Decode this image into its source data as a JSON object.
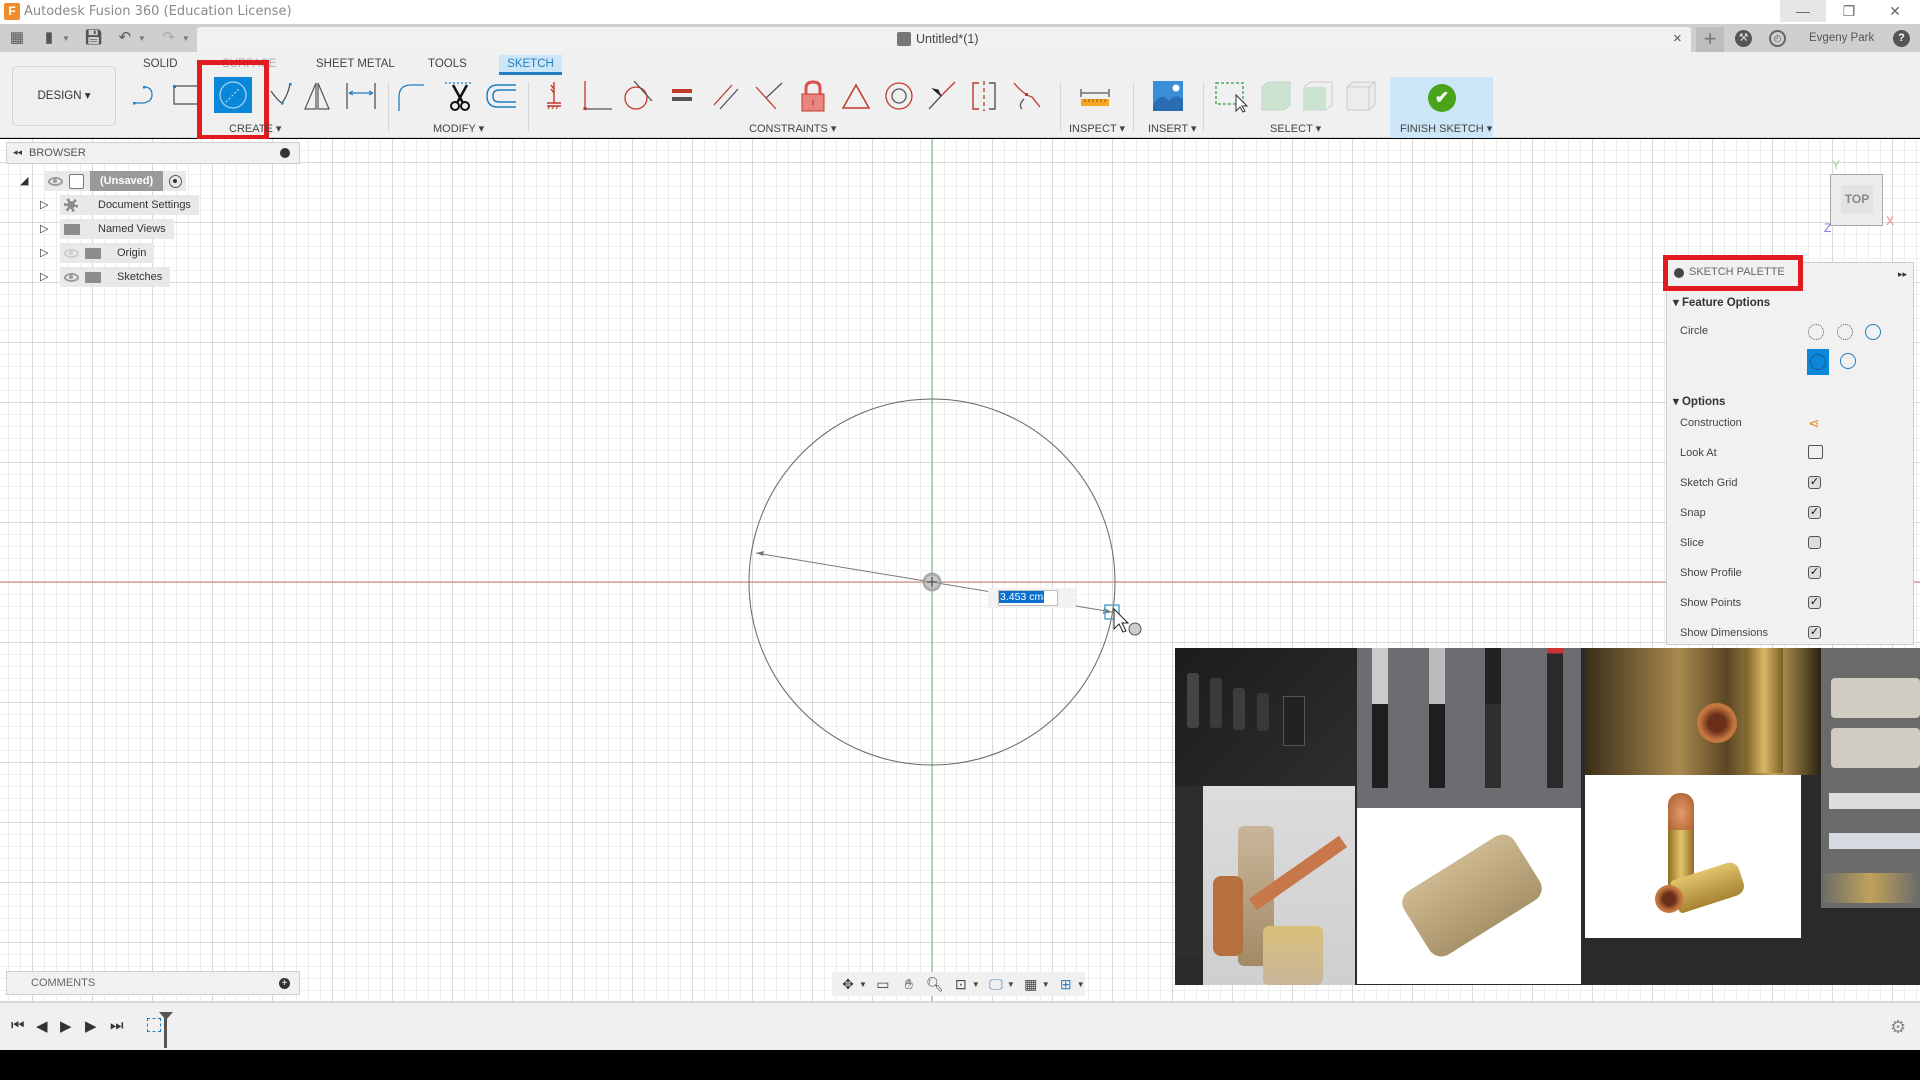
{
  "window": {
    "app_title": "Autodesk Fusion 360 (Education License)",
    "app_logo": "F",
    "controls": {
      "minimize": "—",
      "maximize": "❐",
      "close": "✕"
    }
  },
  "tabstrip": {
    "quick_access": [
      "grid-icon",
      "file-icon",
      "save-icon",
      "undo-icon",
      "redo-icon"
    ],
    "document_title": "Untitled*(1)",
    "close_tab": "×",
    "new_tab": "+",
    "user_name": "Evgeny Park",
    "help": "?"
  },
  "ribbon": {
    "workspace_button": "DESIGN ▾",
    "tabs": [
      "SOLID",
      "SURFACE",
      "SHEET METAL",
      "TOOLS",
      "SKETCH"
    ],
    "active_tab": "SKETCH",
    "groups": {
      "create": "CREATE ▾",
      "modify": "MODIFY ▾",
      "constraints": "CONSTRAINTS ▾",
      "inspect": "INSPECT ▾",
      "insert": "INSERT ▾",
      "select": "SELECT ▾",
      "finish": "FINISH SKETCH ▾"
    },
    "create_tools": [
      "line",
      "rectangle",
      "circle",
      "spline",
      "mirror",
      "sketch-dimension"
    ],
    "active_tool": "circle",
    "modify_tools": [
      "fillet",
      "trim",
      "offset"
    ],
    "constraint_tools": [
      "horizontal-vertical",
      "coincident",
      "tangent",
      "equal",
      "parallel",
      "perpendicular",
      "fix-unfix",
      "midpoint",
      "concentric",
      "collinear",
      "symmetry",
      "curvature"
    ]
  },
  "browser": {
    "title": "BROWSER",
    "root": "(Unsaved)",
    "items": [
      {
        "label": "Document Settings",
        "icon": "gear-icon",
        "eye": false
      },
      {
        "label": "Named Views",
        "icon": "folder-icon",
        "eye": false
      },
      {
        "label": "Origin",
        "icon": "folder-icon",
        "eye": "hidden"
      },
      {
        "label": "Sketches",
        "icon": "folder-icon",
        "eye": "visible"
      }
    ]
  },
  "comments": {
    "title": "COMMENTS"
  },
  "canvas": {
    "dimension_value": "3.453 cm",
    "viewcube": {
      "face": "TOP",
      "axis_y": "Y",
      "axis_x": "X",
      "axis_z": "Z"
    }
  },
  "palette": {
    "title": "SKETCH PALETTE",
    "feature_options_label": "Feature Options",
    "circle_label": "Circle",
    "options_label": "Options",
    "rows": [
      {
        "label": "Construction",
        "control": "construction-icon"
      },
      {
        "label": "Look At",
        "control": "look-at-icon"
      },
      {
        "label": "Sketch Grid",
        "checked": true
      },
      {
        "label": "Snap",
        "checked": true
      },
      {
        "label": "Slice",
        "checked": false
      },
      {
        "label": "Show Profile",
        "checked": true
      },
      {
        "label": "Show Points",
        "checked": true
      },
      {
        "label": "Show Dimensions",
        "checked": true
      }
    ]
  },
  "navbar": {
    "tools": [
      "orbit",
      "look-at",
      "pan",
      "zoom",
      "fit",
      "display-settings",
      "grid-snap",
      "viewports"
    ]
  },
  "timeline": {
    "controls": [
      "first",
      "previous",
      "play",
      "next",
      "last"
    ]
  },
  "colors": {
    "accent": "#0a87d8",
    "highlight_box": "#e21b23",
    "finish_green": "#4aa41a",
    "x_axis": "#c0504d",
    "y_axis": "#5cb85c",
    "constraint_red": "#c0392b"
  }
}
